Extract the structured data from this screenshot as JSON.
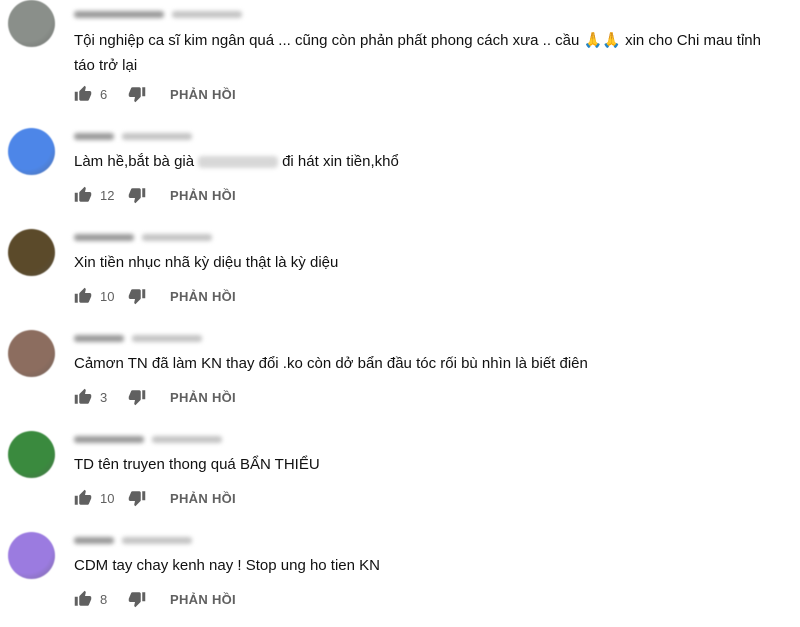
{
  "reply_label": "PHẢN HỒI",
  "comments": [
    {
      "avatar_color": "#8a8f8a",
      "text_line1": "Tội nghiệp ca sĩ kim ngân quá ... cũng còn phản phất phong cách xưa .. cầu",
      "emoji": "🙏🙏",
      "text_line1_end": "xin cho Chi mau tỉnh",
      "text_line2": "táo trở lại",
      "likes": "6"
    },
    {
      "avatar_color": "#4d86e8",
      "text_before": "Làm hề,bắt bà già",
      "text_after": "đi hát xin tiền,khổ",
      "likes": "12"
    },
    {
      "avatar_color": "#5b4a2a",
      "text": "Xin tiền nhục nhã kỳ diệu thật là kỳ diệu",
      "likes": "10"
    },
    {
      "avatar_color": "#8c6d5f",
      "text": "Cảmơn TN đã làm KN thay đổi .ko còn dở bẩn đầu tóc rối bù nhìn là biết điên",
      "likes": "3"
    },
    {
      "avatar_color": "#3a8a3e",
      "text": "TD tên truyen thong quá BẨN THIỂU",
      "likes": "10"
    },
    {
      "avatar_color": "#9b7be0",
      "text": "CDM tay chay kenh nay ! Stop ung ho tien KN",
      "likes": "8"
    }
  ]
}
